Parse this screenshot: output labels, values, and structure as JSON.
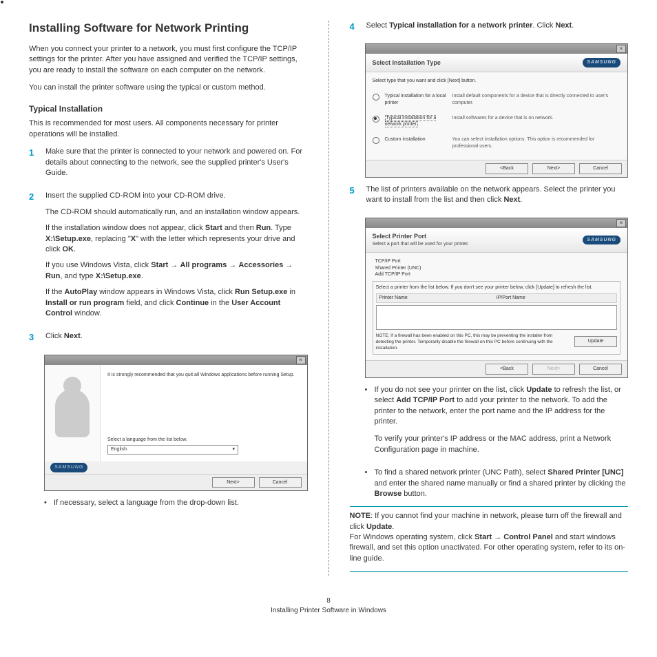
{
  "heading": "Installing Software for Network Printing",
  "intro1": "When you connect your printer to a network, you must first configure the TCP/IP settings for the printer. After you have assigned and verified the TCP/IP settings, you are ready to install the software on each computer on the network.",
  "intro2": "You can install the printer software using the typical or custom method.",
  "typical_heading": "Typical Installation",
  "typical_desc": "This is recommended for most users. All components necessary for printer operations will be installed.",
  "steps": {
    "1": "Make sure that the printer is connected to your network and powered on. For details about connecting to the network, see the supplied printer's User's Guide.",
    "2a": "Insert the supplied CD-ROM into your CD-ROM drive.",
    "2b": "The CD-ROM should automatically run, and an installation window appears.",
    "2c1": "If the installation window does not appear, click ",
    "2c2": " and then ",
    "2c3": ". Type ",
    "2c4": ", replacing \"",
    "2c5": "\" with the letter which represents your drive and click ",
    "2c6": ".",
    "2d1": "If you use Windows Vista, click ",
    "2d2": ", and type ",
    "2d3": ".",
    "2e1": "If the ",
    "2e2": " window appears in Windows Vista, click ",
    "2e3": " in ",
    "2e4": " field, and click ",
    "2e5": " in the ",
    "2e6": " window.",
    "3": "Click ",
    "4a": "Select ",
    "4b": ". Click ",
    "4c": ".",
    "5a": "The list of printers available on the network appears. Select the printer you want to install from the list and then click ",
    "5b": "."
  },
  "bold": {
    "start": "Start",
    "run": "Run",
    "setup": "X:\\Setup.exe",
    "x": "X",
    "ok": "OK",
    "allprograms": "All programs",
    "accessories": "Accessories",
    "autoplay": "AutoPlay",
    "runsetup": "Run Setup.exe",
    "installrun": "Install or run program",
    "continue": "Continue",
    "uac": "User Account Control",
    "next": "Next",
    "typnet": "Typical installation for a network printer",
    "update": "Update",
    "addtcp": "Add TCP/IP Port",
    "sharedunc": "Shared Printer [UNC]",
    "browse": "Browse",
    "controlpanel": "Control Panel",
    "note_label": "NOTE"
  },
  "arrow": "→",
  "screenshot1": {
    "recommend": "It is strongly recommended that you quit all Windows applications before running Setup.",
    "select_lang": "Select a language from the list below.",
    "lang": "English",
    "next": "Next>",
    "cancel": "Cancel",
    "logo": "SAMSUNG"
  },
  "bullet_after_ss1": "If necessary, select a language from the drop-down list.",
  "screenshot2": {
    "title": "Select Installation Type",
    "instruction": "Select type that you want and click [Next] button.",
    "opt1_label": "Typical installation for a local printer",
    "opt1_desc": "Install default components for a device that is directly connected to user's computer.",
    "opt2_label": "Typical installation for a network printer",
    "opt2_desc": "Install softwares for a device that is on network.",
    "opt3_label": "Custom installation",
    "opt3_desc": "You can select installation options. This option is recommended for professional users.",
    "back": "<Back",
    "next": "Next>",
    "cancel": "Cancel",
    "logo": "SAMSUNG"
  },
  "screenshot3": {
    "title": "Select Printer Port",
    "subtitle": "Select a port that will be used for your printer.",
    "opt1": "TCP/IP Port",
    "opt2": "Shared Printer (UNC)",
    "opt3": "Add TCP/IP Port",
    "instruction": "Select a printer from the list below. If you don't see your printer below, click [Update] to refresh the list.",
    "col1": "Printer Name",
    "col2": "IP/Port Name",
    "note": "NOTE: If a firewall has been enabled on this PC, this may be preventing the installer from detecting the printer. Temporarily disable the firewall on this PC before continuing with the installation.",
    "update": "Update",
    "back": "<Back",
    "next": "Next>",
    "cancel": "Cancel",
    "logo": "SAMSUNG"
  },
  "bullets_right": {
    "b1a": "If you do not see your printer on the list, click ",
    "b1b": " to refresh the list, or select ",
    "b1c": " to add your printer to the network. To add the printer to the network, enter the port name and the IP address for the printer.",
    "b1d": "To verify your printer's IP address or the MAC address, print a Network Configuration page in machine.",
    "b2a": "To find a shared network printer (UNC Path), select ",
    "b2b": " and enter the shared name manually or find a shared printer by clicking the ",
    "b2c": " button."
  },
  "note_box": {
    "l1a": ":  If you cannot find your machine in network, please turn off the firewall and click ",
    "l1b": ".",
    "l2a": "For Windows operating system, click ",
    "l2b": " and  start windows firewall, and set this option unactivated. For other operating system, refer to its on-line guide."
  },
  "footer": {
    "page": "8",
    "section": "Installing Printer Software in Windows"
  }
}
